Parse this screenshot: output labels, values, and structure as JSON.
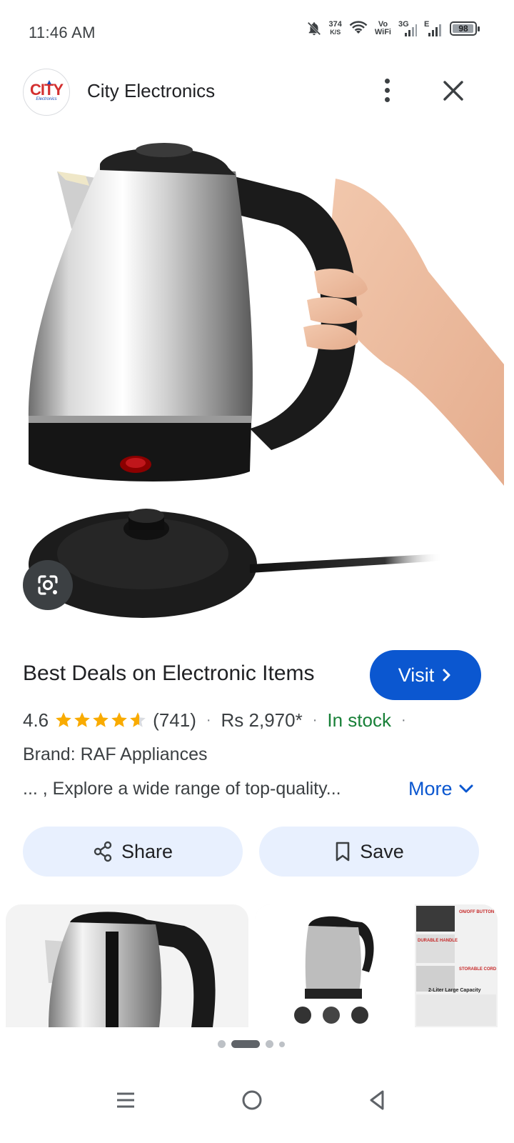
{
  "status_bar": {
    "time": "11:46 AM",
    "speed_value": "374",
    "speed_unit": "K/S",
    "vo": "Vo",
    "wifi_label": "WiFi",
    "net_3g": "3G",
    "net_e": "E",
    "battery": "98",
    "battery_level_percent": 98
  },
  "header": {
    "site_name": "City Electronics",
    "logo_text": "CITY",
    "logo_sub": "Electronics",
    "menu_icon": "more-vert-icon",
    "close_icon": "close-icon"
  },
  "main": {
    "lens_icon": "google-lens-icon",
    "title": "Best Deals on Electronic Items",
    "visit_label": "Visit",
    "rating": "4.6",
    "stars_filled": 4.6,
    "reviews": "(741)",
    "price": "Rs 2,970*",
    "stock": "In stock",
    "brand": "Brand: RAF Appliances",
    "description": "... , Explore a wide range of top-quality...",
    "more_label": "More",
    "share_label": "Share",
    "save_label": "Save"
  },
  "thumbnails": {
    "thumb2_labels": [
      "ON/OFF BUTTON",
      "DURABLE HANDLE",
      "STORABLE CORD",
      "2-Liter Large Capacity"
    ]
  },
  "pager": {
    "count": 4,
    "active": 1
  },
  "nav": {
    "menu_icon": "recents-icon",
    "home_icon": "home-icon",
    "back_icon": "back-icon"
  },
  "colors": {
    "accent": "#0b57d0",
    "stock_green": "#188038",
    "star": "#f9ab00",
    "pill_bg": "#e8f0fe"
  }
}
